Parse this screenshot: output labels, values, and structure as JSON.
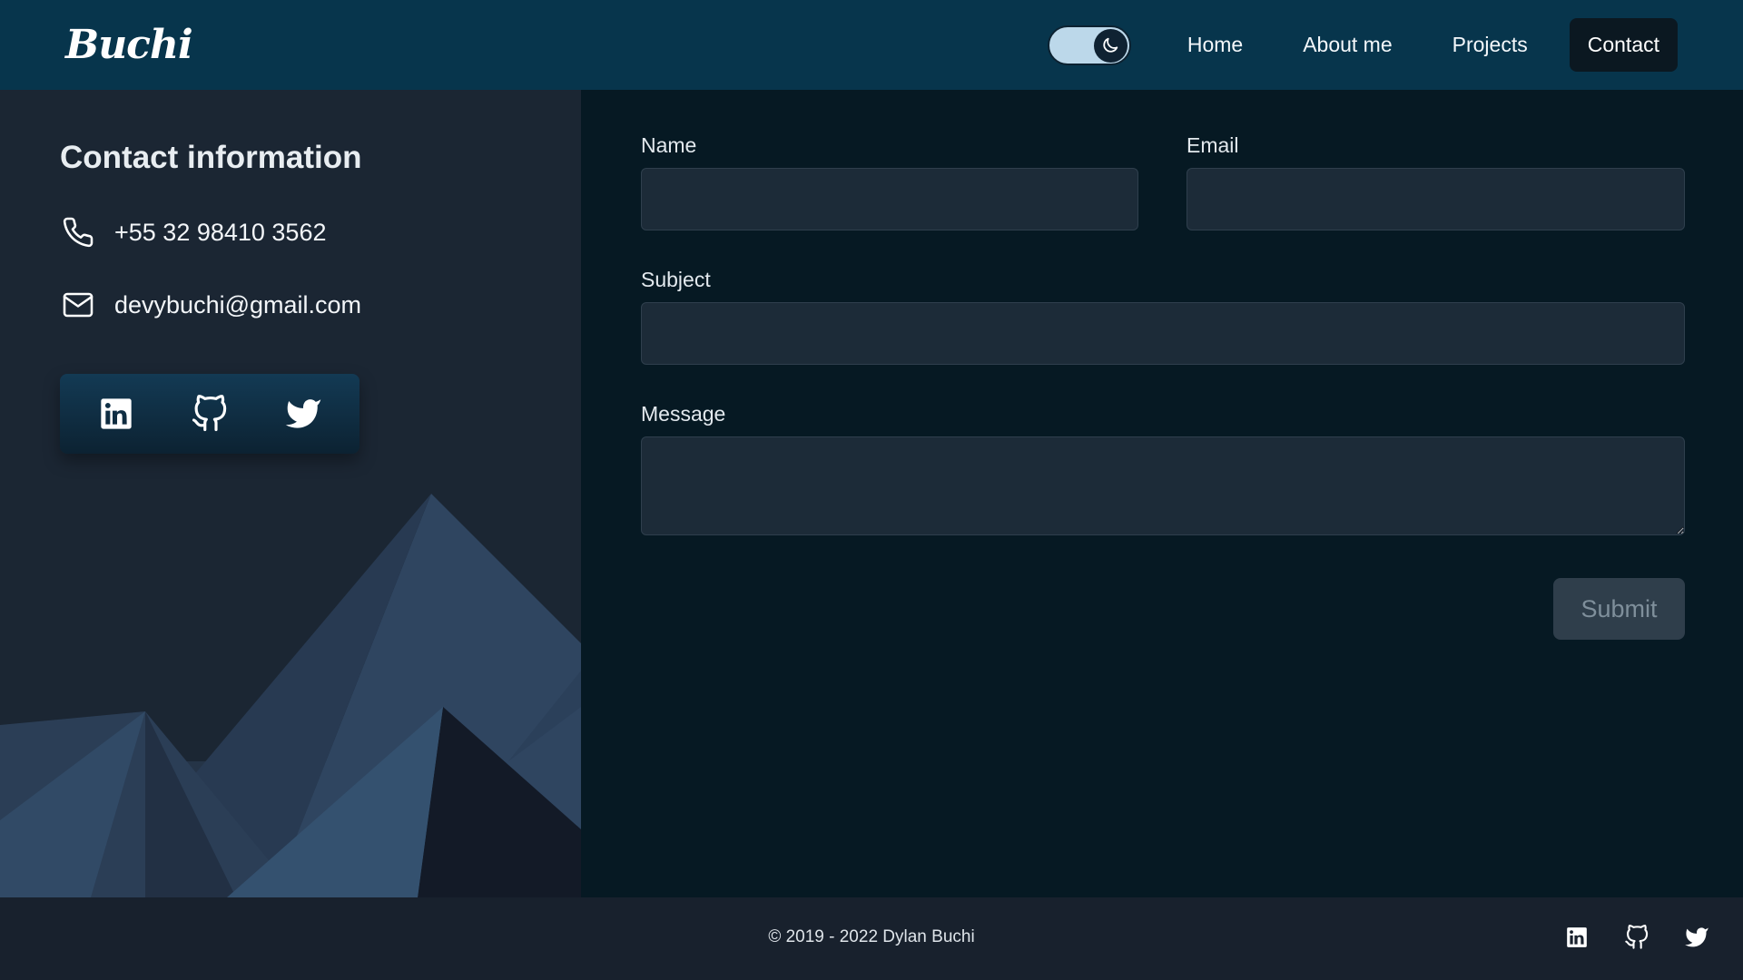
{
  "header": {
    "logo": "Buchi",
    "nav": [
      {
        "label": "Home"
      },
      {
        "label": "About me"
      },
      {
        "label": "Projects"
      },
      {
        "label": "Contact",
        "active": true
      }
    ],
    "theme_toggle": {
      "mode": "dark",
      "icon": "moon-icon"
    }
  },
  "contact": {
    "title": "Contact information",
    "phone": "+55 32 98410 3562",
    "email": "devybuchi@gmail.com",
    "social": [
      "linkedin-icon",
      "github-icon",
      "twitter-icon"
    ]
  },
  "form": {
    "name_label": "Name",
    "email_label": "Email",
    "subject_label": "Subject",
    "message_label": "Message",
    "name_value": "",
    "email_value": "",
    "subject_value": "",
    "message_value": "",
    "submit_label": "Submit"
  },
  "footer": {
    "copyright": "© 2019 - 2022  Dylan Buchi",
    "social": [
      "linkedin-icon",
      "github-icon",
      "twitter-icon"
    ]
  },
  "colors": {
    "header_bg": "#07354c",
    "page_bg": "#061923",
    "panel_bg": "#1b2633",
    "footer_bg": "#18212d",
    "input_bg": "#1c2b38",
    "submit_bg": "#2f3e4b"
  }
}
